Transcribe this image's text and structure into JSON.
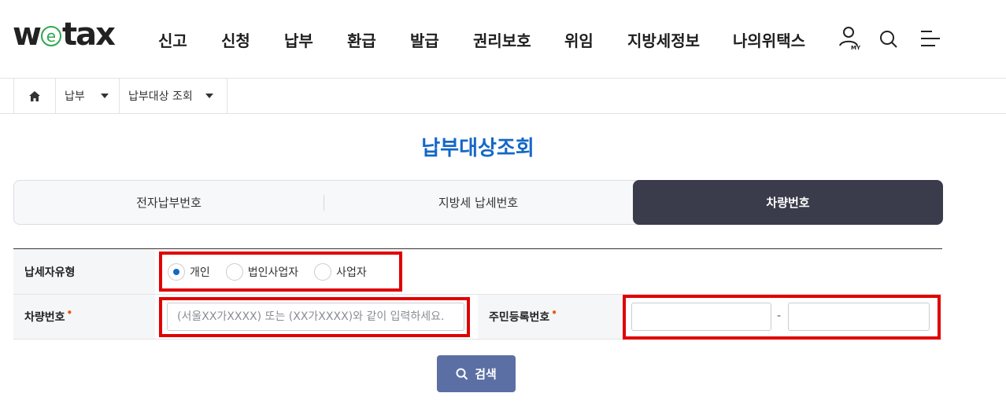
{
  "header": {
    "logo": {
      "prefix": "w",
      "e": "e",
      "suffix": "tax"
    },
    "nav": [
      "신고",
      "신청",
      "납부",
      "환급",
      "발급",
      "권리보호",
      "위임",
      "지방세정보",
      "나의위택스"
    ],
    "my_label": "MY"
  },
  "breadcrumb": {
    "level1": "납부",
    "level2": "납부대상 조회"
  },
  "page": {
    "title": "납부대상조회"
  },
  "tabs": {
    "items": [
      "전자납부번호",
      "지방세 납세번호",
      "차량번호"
    ],
    "active": "차량번호"
  },
  "form": {
    "taxpayer_type": {
      "label": "납세자유형",
      "options": [
        "개인",
        "법인사업자",
        "사업자"
      ],
      "selected": "개인"
    },
    "vehicle_number": {
      "label": "차량번호",
      "required_mark": "•",
      "placeholder": "(서울XX가XXXX) 또는 (XX가XXXX)와 같이 입력하세요.",
      "value": ""
    },
    "resident_number": {
      "label": "주민등록번호",
      "required_mark": "•",
      "separator": "-",
      "part1": "",
      "part2": ""
    }
  },
  "actions": {
    "search_label": "검색"
  },
  "colors": {
    "brand_blue": "#1568c6",
    "active_tab": "#3a3c4b",
    "search_button": "#5b6fa4",
    "highlight_red": "#e00000",
    "logo_green": "#2fa84f"
  }
}
